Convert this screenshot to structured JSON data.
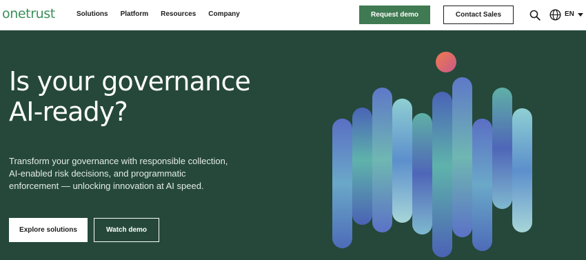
{
  "header": {
    "logo": "onetrust",
    "nav": [
      "Solutions",
      "Platform",
      "Resources",
      "Company"
    ],
    "request_demo": "Request demo",
    "contact_sales": "Contact Sales",
    "language": "EN"
  },
  "hero": {
    "title_lines": [
      "Is your governance",
      "AI-ready?"
    ],
    "subtitle_lines": [
      "Transform your governance with responsible collection,",
      "AI-enabled risk decisions, and programmatic",
      "enforcement — unlocking innovation at AI speed."
    ],
    "primary_button": "Explore solutions",
    "secondary_button": "Watch demo"
  },
  "colors": {
    "brand_green": "#3b8f5a",
    "button_green": "#3f7a52",
    "hero_background": "#25483a",
    "orb": "#e06b5a"
  },
  "icons": {
    "search": "search-icon",
    "globe": "globe-icon",
    "caret": "caret-down-icon",
    "decoration": "gradient-pills-illustration"
  }
}
